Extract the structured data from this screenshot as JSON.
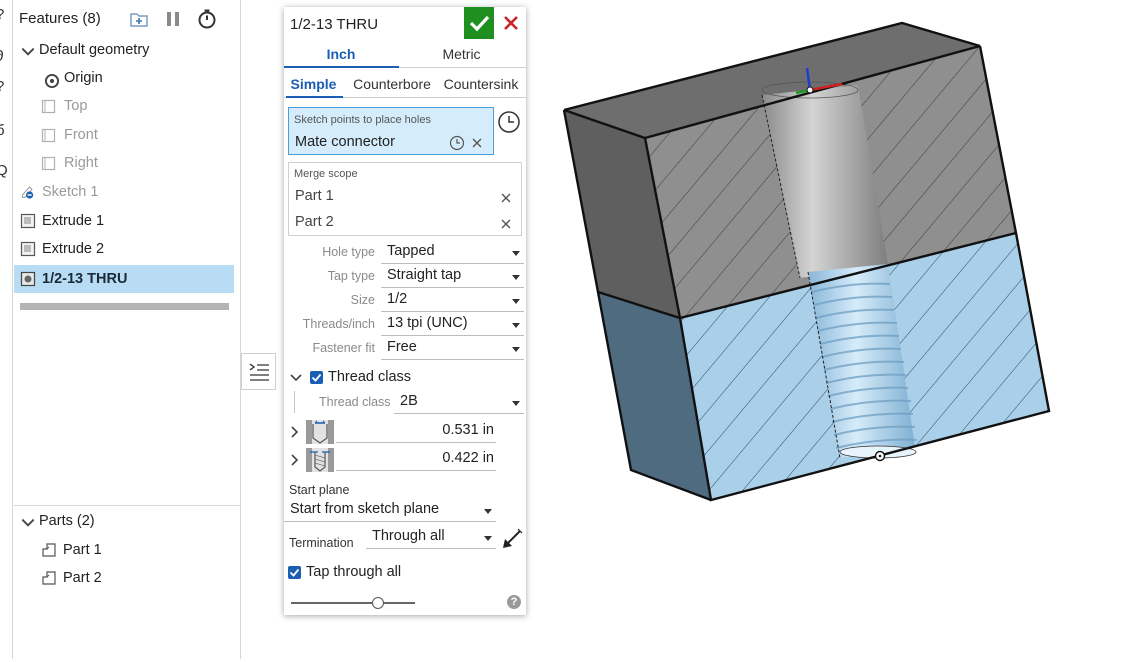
{
  "feature_panel": {
    "title": "Features (8)",
    "items": [
      {
        "label": "Default geometry",
        "kind": "group"
      },
      {
        "label": "Origin",
        "kind": "origin"
      },
      {
        "label": "Top",
        "kind": "plane"
      },
      {
        "label": "Front",
        "kind": "plane"
      },
      {
        "label": "Right",
        "kind": "plane"
      },
      {
        "label": "Sketch 1",
        "kind": "sketch"
      },
      {
        "label": "Extrude 1",
        "kind": "extrude"
      },
      {
        "label": "Extrude 2",
        "kind": "extrude"
      },
      {
        "label": "1/2-13 THRU",
        "kind": "hole",
        "selected": true
      }
    ],
    "parts_header": "Parts (2)",
    "parts": [
      "Part 1",
      "Part 2"
    ]
  },
  "dialog": {
    "title": "1/2-13 THRU",
    "unit_tabs": [
      "Inch",
      "Metric"
    ],
    "active_unit": "Inch",
    "style_tabs": [
      "Simple",
      "Counterbore",
      "Countersink"
    ],
    "active_style": "Simple",
    "sketch_points": {
      "label": "Sketch points to place holes",
      "value": "Mate connector"
    },
    "merge_scope": {
      "label": "Merge scope",
      "items": [
        "Part 1",
        "Part 2"
      ]
    },
    "params": [
      {
        "label": "Hole type",
        "value": "Tapped"
      },
      {
        "label": "Tap type",
        "value": "Straight tap"
      },
      {
        "label": "Size",
        "value": "1/2"
      },
      {
        "label": "Threads/inch",
        "value": "13 tpi (UNC)"
      },
      {
        "label": "Fastener fit",
        "value": "Free"
      }
    ],
    "thread_class": {
      "checkbox_label": "Thread class",
      "checked": true,
      "field_label": "Thread class",
      "value": "2B"
    },
    "dimensions": [
      {
        "value": "0.531 in",
        "icon": "tap-drill-diameter-icon"
      },
      {
        "value": "0.422 in",
        "icon": "thread-depth-icon"
      }
    ],
    "start_plane": {
      "label": "Start plane",
      "value": "Start from sketch plane"
    },
    "termination": {
      "label": "Termination",
      "value": "Through all"
    },
    "tap_through_all": {
      "label": "Tap through all",
      "checked": true
    },
    "slider_level": 0.7
  },
  "colors": {
    "accent": "#1a5fb4",
    "ok": "#1f8f1f",
    "cancel": "#c62828",
    "selection": "#b8dcf3",
    "part_top": "#8c8c8c",
    "part_bottom": "#a9cfe9"
  }
}
